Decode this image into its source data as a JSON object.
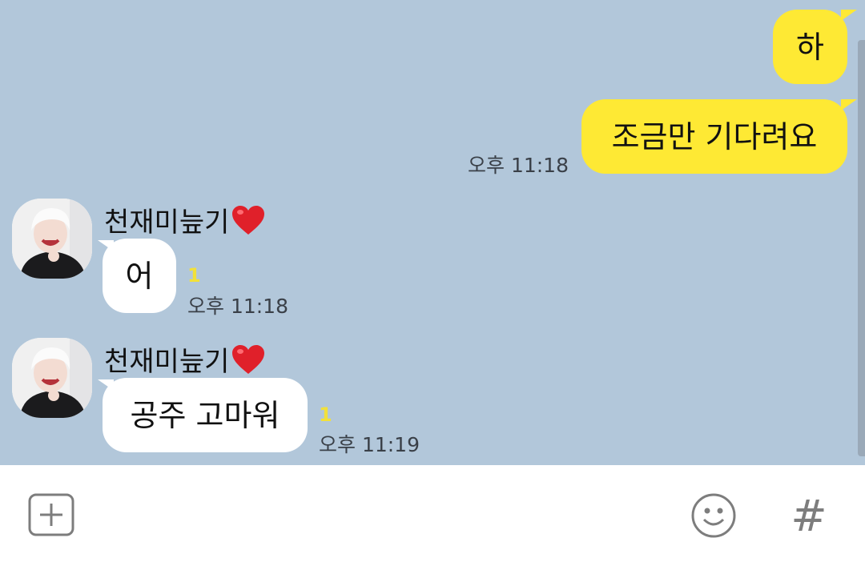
{
  "messages": [
    {
      "text": "하"
    },
    {
      "text": "조금만 기다려요",
      "time": "오후 11:18"
    },
    {
      "sender": "천재미늪기",
      "text": "어",
      "unread": "1",
      "time": "오후 11:18"
    },
    {
      "sender": "천재미늪기",
      "text": "공주 고마워",
      "unread": "1",
      "time": "오후 11:19"
    }
  ],
  "colors": {
    "chat_background": "#b2c7da",
    "my_bubble": "#fee934",
    "other_bubble": "#ffffff",
    "unread": "#f2e13a",
    "heart": "#e0202a"
  },
  "icons": {
    "attach": "plus-square-icon",
    "emoji": "smiley-icon",
    "hashtag": "hash-icon",
    "heart": "heart-icon"
  },
  "input": {
    "hashtag_symbol": "#"
  }
}
